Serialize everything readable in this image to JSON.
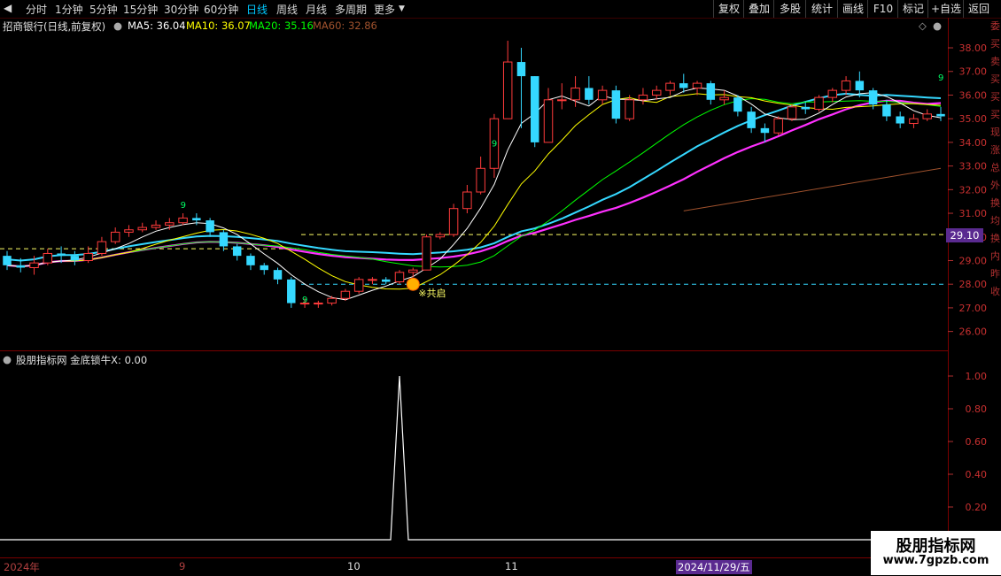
{
  "toolbar": {
    "periods": [
      "分时",
      "1分钟",
      "5分钟",
      "15分钟",
      "30分钟",
      "60分钟",
      "日线",
      "周线",
      "月线",
      "多周期",
      "更多"
    ],
    "active": "日线",
    "right_buttons": [
      "复权",
      "叠加",
      "多股",
      "统计",
      "画线",
      "F10",
      "标记",
      "+自选",
      "返回"
    ]
  },
  "info": {
    "title": "招商银行(日线,前复权)",
    "ma5": "MA5: 36.04",
    "ma10": "MA10: 36.07",
    "ma20": "MA20: 35.16",
    "ma60": "MA60: 32.86",
    "colors": {
      "ma5": "#ffffff",
      "ma10": "#ffff00",
      "ma20": "#00ff00",
      "ma60": "#a0522d"
    }
  },
  "price_axis": [
    "38.00",
    "37.00",
    "36.00",
    "35.00",
    "34.00",
    "33.00",
    "32.00",
    "31.00",
    "30.00",
    "29.00",
    "28.00",
    "27.00",
    "26.00"
  ],
  "price_tag": "29.10",
  "annotation": {
    "marker_text": "※共启",
    "nine_label": "9"
  },
  "sub": {
    "header": "股朋指标网 金底锁牛X: 0.00",
    "axis": [
      "1.00",
      "0.80",
      "0.60",
      "0.40",
      "0.20"
    ]
  },
  "dates": {
    "year": "2024年",
    "m9": "9",
    "m10": "10",
    "m11": "11",
    "cursor": "2024/11/29/五"
  },
  "edge_text": "委买卖买买买现涨总外换均换内昨收",
  "watermark": {
    "line1": "股朋指标网",
    "line2": "www.7gpzb.com"
  },
  "chart_data": {
    "type": "candlestick",
    "y_range": [
      25.2,
      38.6
    ],
    "x_categories": 70,
    "candles": [
      [
        29.2,
        28.8,
        29.4,
        28.6
      ],
      [
        28.8,
        28.7,
        29.1,
        28.5
      ],
      [
        28.7,
        28.9,
        29.2,
        28.4
      ],
      [
        28.9,
        29.3,
        29.5,
        28.8
      ],
      [
        29.3,
        29.2,
        29.6,
        28.9
      ],
      [
        29.2,
        29.0,
        29.4,
        28.8
      ],
      [
        29.0,
        29.3,
        29.6,
        28.9
      ],
      [
        29.3,
        29.8,
        30.0,
        29.2
      ],
      [
        29.8,
        30.2,
        30.4,
        29.7
      ],
      [
        30.2,
        30.3,
        30.5,
        30.0
      ],
      [
        30.3,
        30.4,
        30.6,
        30.2
      ],
      [
        30.4,
        30.5,
        30.7,
        30.3
      ],
      [
        30.5,
        30.6,
        30.8,
        30.3
      ],
      [
        30.6,
        30.8,
        31.0,
        30.5
      ],
      [
        30.8,
        30.7,
        31.0,
        30.5
      ],
      [
        30.7,
        30.2,
        30.8,
        30.0
      ],
      [
        30.2,
        29.6,
        30.3,
        29.4
      ],
      [
        29.6,
        29.2,
        29.7,
        29.0
      ],
      [
        29.2,
        28.8,
        29.3,
        28.6
      ],
      [
        28.8,
        28.6,
        28.9,
        28.4
      ],
      [
        28.6,
        28.2,
        28.7,
        28.0
      ],
      [
        28.2,
        27.2,
        28.3,
        27.0
      ],
      [
        27.2,
        27.2,
        27.4,
        27.0
      ],
      [
        27.2,
        27.2,
        27.3,
        27.0
      ],
      [
        27.2,
        27.4,
        27.5,
        27.1
      ],
      [
        27.4,
        27.7,
        27.8,
        27.3
      ],
      [
        27.7,
        28.2,
        28.3,
        27.6
      ],
      [
        28.2,
        28.2,
        28.3,
        28.0
      ],
      [
        28.2,
        28.1,
        28.3,
        28.0
      ],
      [
        28.1,
        28.5,
        28.6,
        28.0
      ],
      [
        28.5,
        28.6,
        28.7,
        28.3
      ],
      [
        28.6,
        30.0,
        30.1,
        28.6
      ],
      [
        30.0,
        30.1,
        30.2,
        29.9
      ],
      [
        30.1,
        31.2,
        31.4,
        30.0
      ],
      [
        31.2,
        31.9,
        32.2,
        31.0
      ],
      [
        31.9,
        32.9,
        33.4,
        31.8
      ],
      [
        32.9,
        35.0,
        35.2,
        32.5
      ],
      [
        35.0,
        37.4,
        38.3,
        35.0
      ],
      [
        37.4,
        36.8,
        38.0,
        34.6
      ],
      [
        36.8,
        34.0,
        36.8,
        33.8
      ],
      [
        34.0,
        35.8,
        36.3,
        34.0
      ],
      [
        35.8,
        35.8,
        36.5,
        35.4
      ],
      [
        35.8,
        36.3,
        36.8,
        35.5
      ],
      [
        36.3,
        35.8,
        36.8,
        35.6
      ],
      [
        35.8,
        36.2,
        36.4,
        35.6
      ],
      [
        36.2,
        35.0,
        36.4,
        34.8
      ],
      [
        35.0,
        35.8,
        36.0,
        34.9
      ],
      [
        35.8,
        36.0,
        36.3,
        35.6
      ],
      [
        36.0,
        36.2,
        36.4,
        35.8
      ],
      [
        36.2,
        36.5,
        36.6,
        36.0
      ],
      [
        36.5,
        36.3,
        36.9,
        36.1
      ],
      [
        36.3,
        36.5,
        36.6,
        36.0
      ],
      [
        36.5,
        35.8,
        36.6,
        35.6
      ],
      [
        35.8,
        35.9,
        36.2,
        35.6
      ],
      [
        35.9,
        35.3,
        36.0,
        35.1
      ],
      [
        35.3,
        34.6,
        35.5,
        34.4
      ],
      [
        34.6,
        34.4,
        34.8,
        34.0
      ],
      [
        34.4,
        35.0,
        35.1,
        34.3
      ],
      [
        35.0,
        35.5,
        35.6,
        34.9
      ],
      [
        35.5,
        35.4,
        35.7,
        35.2
      ],
      [
        35.4,
        35.9,
        36.0,
        35.3
      ],
      [
        35.9,
        36.2,
        36.3,
        35.7
      ],
      [
        36.2,
        36.6,
        36.8,
        36.0
      ],
      [
        36.6,
        36.2,
        37.0,
        35.9
      ],
      [
        36.2,
        35.6,
        36.3,
        35.4
      ],
      [
        35.6,
        35.1,
        35.8,
        34.9
      ],
      [
        35.1,
        34.8,
        35.3,
        34.6
      ],
      [
        34.8,
        35.0,
        35.2,
        34.6
      ],
      [
        35.0,
        35.2,
        35.4,
        34.9
      ],
      [
        35.2,
        35.1,
        35.5,
        34.9
      ]
    ]
  }
}
